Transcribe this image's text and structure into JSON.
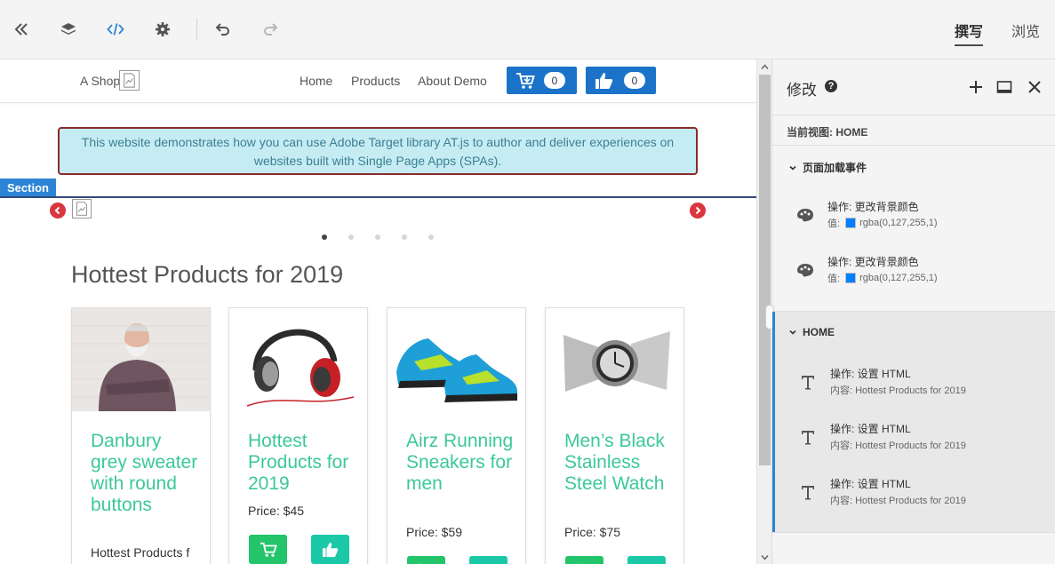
{
  "toolbar": {
    "icons": [
      "collapse-left-icon",
      "layers-icon",
      "code-icon",
      "settings-gear-icon",
      "undo-icon",
      "redo-icon"
    ],
    "mode_tabs": [
      {
        "label": "撰写",
        "active": true
      },
      {
        "label": "浏览",
        "active": false
      }
    ]
  },
  "site": {
    "brand": "A Shop",
    "nav": [
      "Home",
      "Products",
      "About Demo"
    ],
    "cart_count": "0",
    "like_count": "0",
    "notice": "This website demonstrates how you can use Adobe Target library AT.js to author and deliver experiences on websites built with Single Page Apps (SPAs).",
    "section_tag": "Section",
    "carousel_dots": 5,
    "hot_title": "Hottest Products for 2019",
    "products": [
      {
        "name": "Danbury grey sweater with round buttons",
        "price": "",
        "extra": "Hottest Products f",
        "image": "man-in-grey-sweater"
      },
      {
        "name": "Hottest Products for 2019",
        "price": "Price: $45",
        "extra": "",
        "image": "red-headphones"
      },
      {
        "name": "Airz Running Sneakers for men",
        "price": "Price: $59",
        "extra": "",
        "image": "blue-sneakers"
      },
      {
        "name": "Men’s Black Stainless Steel Watch",
        "price": "Price: $75",
        "extra": "",
        "image": "steel-watch"
      }
    ],
    "colors": {
      "accent": "#1a73c9",
      "product_name": "#3cc89a",
      "cart_btn": "#23c46a",
      "like_btn": "#1bc8a8",
      "notice_bg": "#c6ecf3",
      "notice_border": "#8b2b2b"
    }
  },
  "panel": {
    "title": "修改",
    "help": "?",
    "current_view": "当前视图: HOME",
    "groups": [
      {
        "title": "页面加载事件",
        "actions": [
          {
            "title": "操作: 更改背景颜色",
            "label": "值:",
            "value": "rgba(0,127,255,1)",
            "icon": "palette-icon"
          },
          {
            "title": "操作: 更改背景颜色",
            "label": "值:",
            "value": "rgba(0,127,255,1)",
            "icon": "palette-icon"
          }
        ]
      },
      {
        "title": "HOME",
        "actions": [
          {
            "title": "操作: 设置 HTML",
            "content": "内容: Hottest Products for 2019",
            "icon": "text-icon"
          },
          {
            "title": "操作: 设置 HTML",
            "content": "内容: Hottest Products for 2019",
            "icon": "text-icon"
          },
          {
            "title": "操作: 设置 HTML",
            "content": "内容: Hottest Products for 2019",
            "icon": "text-icon"
          }
        ]
      }
    ]
  }
}
